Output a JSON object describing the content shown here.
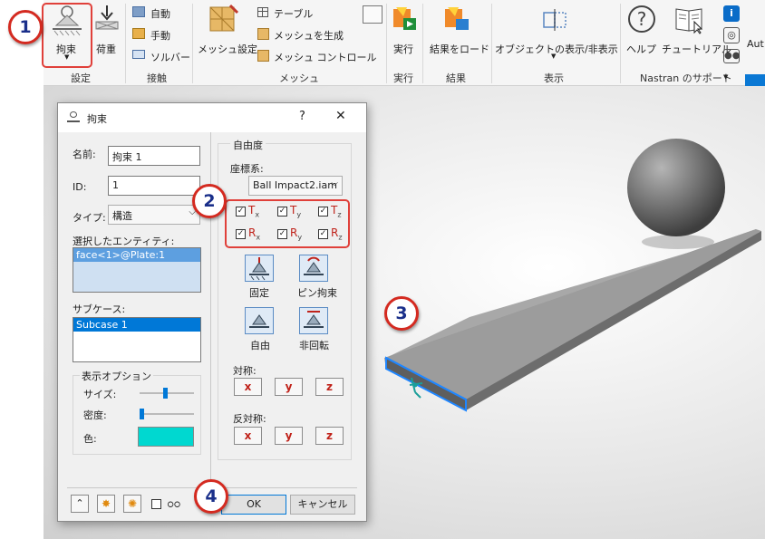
{
  "ribbon": {
    "setup": {
      "constraint": "拘束",
      "load": "荷重",
      "panel": "設定"
    },
    "contacts": {
      "auto": "自動",
      "manual": "手動",
      "solver": "ソルバー",
      "panel": "接触"
    },
    "mesh": {
      "settings": "メッシュ設定",
      "table": "テーブル",
      "generate": "メッシュを生成",
      "control": "メッシュ コントロール",
      "panel": "メッシュ"
    },
    "run": {
      "run": "実行",
      "panel": "実行"
    },
    "results": {
      "load": "結果をロード",
      "panel": "結果"
    },
    "display": {
      "toggle": "オブジェクトの表示/非表示",
      "panel": "表示"
    },
    "support": {
      "help": "ヘルプ",
      "tutorial": "チュートリアル",
      "panel": "Nastran のサポート",
      "cut": "Aut"
    }
  },
  "dialog": {
    "title": "拘束",
    "help": "?",
    "close": "✕",
    "name_label": "名前:",
    "name_value": "拘束 1",
    "id_label": "ID:",
    "id_value": "1",
    "type_label": "タイプ:",
    "type_value": "構造",
    "entities_label": "選択したエンティティ:",
    "entity_item": "face<1>@Plate:1",
    "subcase_label": "サブケース:",
    "subcase_item": "Subcase 1",
    "display_options": "表示オプション",
    "size_label": "サイズ:",
    "density_label": "密度:",
    "color_label": "色:",
    "color_value": "#00d8d0",
    "dof_title": "自由度",
    "csys_label": "座標系:",
    "csys_value": "Ball Impact2.iam",
    "dof": [
      "T",
      "T",
      "T",
      "R",
      "R",
      "R"
    ],
    "dof_sub": [
      "x",
      "y",
      "z",
      "x",
      "y",
      "z"
    ],
    "fixed": "固定",
    "pin": "ピン拘束",
    "free": "自由",
    "no_rotation": "非回転",
    "symmetry_label": "対称:",
    "antisymmetry_label": "反対称:",
    "axes": [
      "x",
      "y",
      "z"
    ],
    "ok": "OK",
    "cancel": "キャンセル"
  },
  "badges": [
    "1",
    "2",
    "3",
    "4"
  ]
}
